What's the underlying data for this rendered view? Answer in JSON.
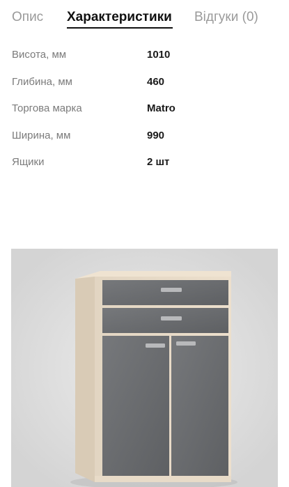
{
  "tabs": [
    {
      "label": "Опис",
      "active": false
    },
    {
      "label": "Характеристики",
      "active": true
    },
    {
      "label": "Відгуки (0)",
      "active": false
    }
  ],
  "specs": [
    {
      "label": "Висота, мм",
      "value": "1010"
    },
    {
      "label": "Глибина, мм",
      "value": "460"
    },
    {
      "label": "Торгова марка",
      "value": "Matro"
    },
    {
      "label": "Ширина, мм",
      "value": "990"
    },
    {
      "label": "Ящики",
      "value": "2 шт"
    }
  ],
  "product_image": {
    "subject": "dresser-with-two-drawers-and-two-doors",
    "colors": {
      "body": "#e6d9c6",
      "fronts": "#6b6d70",
      "handles": "#b8b9bb",
      "backdrop_light": "#f3f3f3",
      "backdrop_mid": "#d9d9d9"
    }
  }
}
